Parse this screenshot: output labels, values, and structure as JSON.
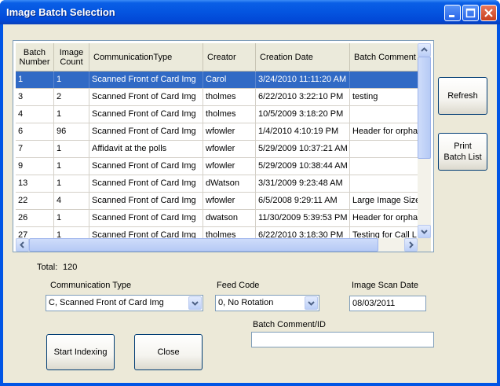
{
  "window": {
    "title": "Image Batch Selection"
  },
  "grid": {
    "columns": [
      "Batch\nNumber",
      "Image\nCount",
      "CommunicationType",
      "Creator",
      "Creation Date",
      "Batch Comment"
    ],
    "rows": [
      [
        "1",
        "1",
        "Scanned Front of Card Img",
        "Carol",
        "3/24/2010 11:11:20 AM",
        ""
      ],
      [
        "3",
        "2",
        "Scanned Front of Card Img",
        "tholmes",
        "6/22/2010 3:22:10 PM",
        "testing"
      ],
      [
        "4",
        "1",
        "Scanned Front of Card Img",
        "tholmes",
        "10/5/2009 3:18:20 PM",
        ""
      ],
      [
        "6",
        "96",
        "Scanned Front of Card Img",
        "wfowler",
        "1/4/2010 4:10:19 PM",
        "Header for orpha"
      ],
      [
        "7",
        "1",
        "Affidavit at the polls",
        "wfowler",
        "5/29/2009 10:37:21 AM",
        ""
      ],
      [
        "9",
        "1",
        "Scanned Front of Card Img",
        "wfowler",
        "5/29/2009 10:38:44 AM",
        ""
      ],
      [
        "13",
        "1",
        "Scanned Front of Card Img",
        "dWatson",
        "3/31/2009 9:23:48 AM",
        ""
      ],
      [
        "22",
        "4",
        "Scanned Front of Card Img",
        "wfowler",
        "6/5/2008 9:29:11 AM",
        "Large Image Size"
      ],
      [
        "26",
        "1",
        "Scanned Front of Card Img",
        "dwatson",
        "11/30/2009 5:39:53 PM",
        "Header for orpha"
      ],
      [
        "27",
        "1",
        "Scanned Front of Card Img",
        "tholmes",
        "6/22/2010 3:18:30 PM",
        "Testing for Call L"
      ]
    ],
    "selected_row": 0
  },
  "buttons": {
    "refresh": "Refresh",
    "print": "Print\nBatch List",
    "start": "Start Indexing",
    "close": "Close"
  },
  "total": {
    "label": "Total:",
    "value": "120"
  },
  "fields": {
    "comm_type": {
      "label": "Communication Type",
      "value": "C, Scanned Front of Card Img"
    },
    "feed_code": {
      "label": "Feed Code",
      "value": "0, No Rotation"
    },
    "scan_date": {
      "label": "Image Scan Date",
      "value": "08/03/2011"
    },
    "batch_comment": {
      "label": "Batch Comment/ID",
      "value": ""
    }
  },
  "colors": {
    "selection": "#316ac5",
    "titlebar": "#0454e0",
    "face": "#ece9d8"
  }
}
